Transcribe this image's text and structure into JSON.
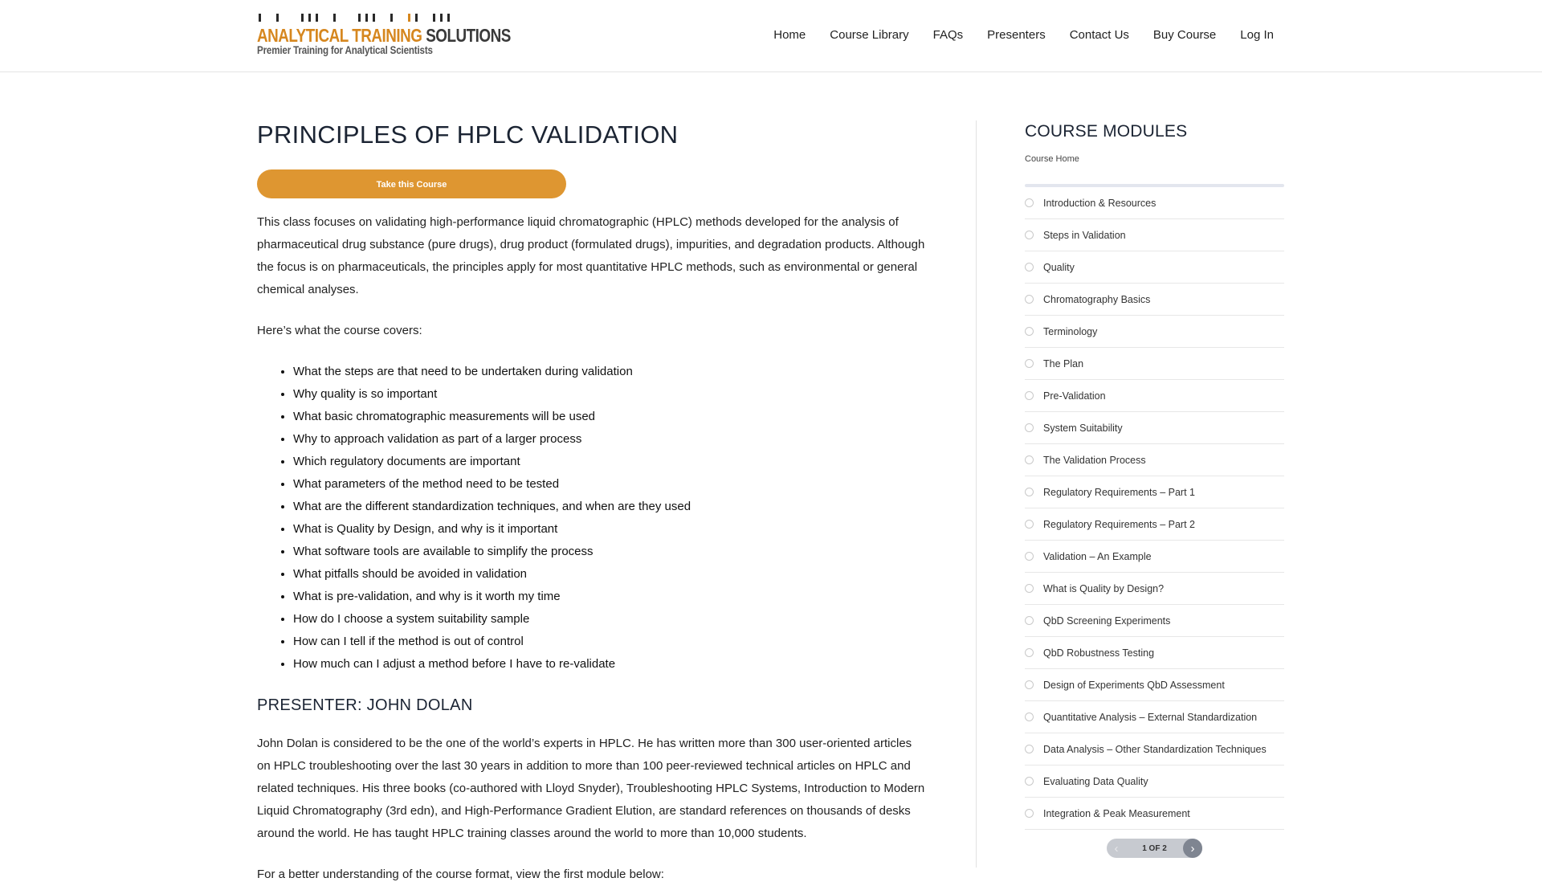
{
  "header": {
    "logo": {
      "line1_accent": "ANALYTICAL TRAINING",
      "line1_main": "SOLUTIONS",
      "tagline": "Premier Training for Analytical Scientists"
    },
    "nav": [
      "Home",
      "Course Library",
      "FAQs",
      "Presenters",
      "Contact Us",
      "Buy Course",
      "Log In"
    ]
  },
  "main": {
    "title": "PRINCIPLES OF HPLC VALIDATION",
    "take_button": "Take this Course",
    "intro": "This class focuses on validating high-performance liquid chromatographic (HPLC) methods developed for the analysis of pharmaceutical drug substance (pure drugs), drug product (formulated drugs), impurities, and degradation products. Although the focus is on pharmaceuticals, the principles apply for most quantitative HPLC methods, such as environmental or general chemical analyses.",
    "covers_heading": "Here’s what the course covers:",
    "topics": [
      "What the steps are that need to be undertaken during validation",
      "Why quality is so important",
      "What basic chromatographic measurements will be used",
      "Why to approach validation as part of a larger process",
      "Which regulatory documents are important",
      "What parameters of the method need to be tested",
      "What are the different standardization techniques, and when are they used",
      "What is Quality by Design, and why is it important",
      "What software tools are available to simplify the process",
      "What pitfalls should be avoided in validation",
      "What is pre-validation, and why is it worth my time",
      "How do I choose a system suitability sample",
      "How can I tell if the method is out of control",
      "How much can I adjust a method before I have to re-validate"
    ],
    "presenter_title": "PRESENTER: JOHN DOLAN",
    "bio": "John Dolan is considered to be the one of the world’s experts in HPLC. He has written more than 300 user-oriented articles on HPLC troubleshooting over the last 30 years in addition to more than 100 peer-reviewed technical articles on HPLC and related techniques. His three books (co-authored with Lloyd Snyder), Troubleshooting HPLC Systems, Introduction to Modern Liquid Chromatography (3rd edn), and High-Performance Gradient Elution, are standard references on thousands of desks around the world. He has taught HPLC training classes around the world to more than 10,000 students.",
    "more": "For a better understanding of the course format, view the first module below:"
  },
  "sidebar": {
    "title": "COURSE MODULES",
    "subtitle": "Course Home",
    "modules": [
      "Introduction & Resources",
      "Steps in Validation",
      "Quality",
      "Chromatography Basics",
      "Terminology",
      "The Plan",
      "Pre-Validation",
      "System Suitability",
      "The Validation Process",
      "Regulatory Requirements – Part 1",
      "Regulatory Requirements – Part 2",
      "Validation – An Example",
      "What is Quality by Design?",
      "QbD Screening Experiments",
      "QbD Robustness Testing",
      "Design of Experiments QbD Assessment",
      "Quantitative Analysis – External Standardization",
      "Data Analysis – Other Standardization Techniques",
      "Evaluating Data Quality",
      "Integration & Peak Measurement"
    ],
    "pager": {
      "label": "1 OF 2",
      "prev_icon": "chevron-left-icon",
      "next_icon": "chevron-right-icon"
    }
  },
  "colors": {
    "accent": "#de9631",
    "logo_orange": "#d6871f",
    "heading": "#1b2433",
    "pager_active": "#7f8591"
  }
}
